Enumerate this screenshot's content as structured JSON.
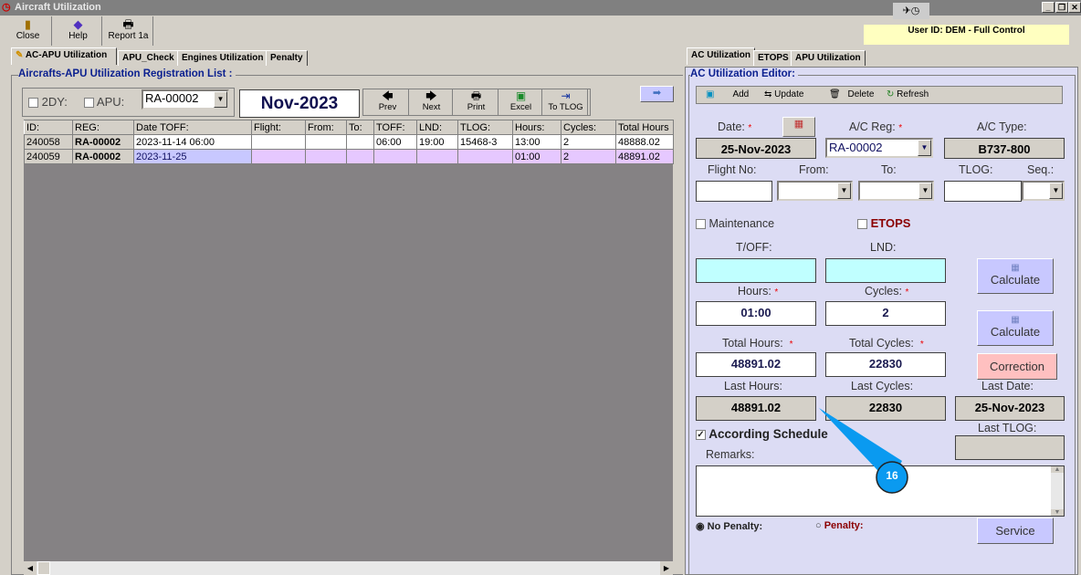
{
  "window": {
    "title": "Aircraft Utilization",
    "user": "User ID: DEM - Full Control"
  },
  "toolbar": [
    {
      "label": "Close",
      "icon": "door-exit-icon"
    },
    {
      "label": "Help",
      "icon": "help-book-icon"
    },
    {
      "label": "Report 1a",
      "icon": "printer-icon"
    }
  ],
  "left_tabs": [
    "AC-APU Utilization",
    "APU_Check",
    "Engines Utilization",
    "Penalty"
  ],
  "list": {
    "title": "Aircrafts-APU Utilization Registration List :",
    "chk_2dy": "2DY:",
    "chk_apu": "APU:",
    "reg": "RA-00002",
    "period": "Nov-2023",
    "nav": [
      "Prev",
      "Next",
      "Print",
      "Excel",
      "To TLOG"
    ],
    "columns": [
      "ID:",
      "REG:",
      "Date TOFF:",
      "Flight:",
      "From:",
      "To:",
      "TOFF:",
      "LND:",
      "TLOG:",
      "Hours:",
      "Cycles:",
      "Total Hours"
    ],
    "rows": [
      [
        "240058",
        "RA-00002",
        "2023-11-14 06:00",
        "",
        "",
        "",
        "06:00",
        "19:00",
        "15468-3",
        "13:00",
        "2",
        "48888.02"
      ],
      [
        "240059",
        "RA-00002",
        "2023-11-25",
        "",
        "",
        "",
        "",
        "",
        "",
        "01:00",
        "2",
        "48891.02"
      ]
    ]
  },
  "right_tabs": [
    "AC Utilization",
    "ETOPS",
    "APU Utilization"
  ],
  "editor": {
    "title": "AC Utilization Editor:",
    "toolbar": [
      "Add",
      "Update",
      "Delete",
      "Refresh"
    ],
    "date_label": "Date:",
    "date": "25-Nov-2023",
    "reg_label": "A/C Reg:",
    "reg": "RA-00002",
    "type_label": "A/C Type:",
    "type": "B737-800",
    "flight_label": "Flight No:",
    "from_label": "From:",
    "to_label": "To:",
    "tlog_label": "TLOG:",
    "seq_label": "Seq.:",
    "maintenance": "Maintenance",
    "etops": "ETOPS",
    "toff_label": "T/OFF:",
    "lnd_label": "LND:",
    "calculate": "Calculate",
    "hours_label": "Hours:",
    "hours": "01:00",
    "cycles_label": "Cycles:",
    "cycles": "2",
    "total_hours_label": "Total Hours:",
    "total_hours": "48891.02",
    "total_cycles_label": "Total Cycles:",
    "total_cycles": "22830",
    "correction": "Correction",
    "last_hours_label": "Last Hours:",
    "last_hours": "48891.02",
    "last_cycles_label": "Last Cycles:",
    "last_cycles": "22830",
    "last_date_label": "Last Date:",
    "last_date": "25-Nov-2023",
    "according": "According Schedule",
    "last_tlog_label": "Last TLOG:",
    "remarks_label": "Remarks:",
    "no_penalty": "No Penalty:",
    "penalty": "Penalty:",
    "service": "Service"
  },
  "callout": "16"
}
